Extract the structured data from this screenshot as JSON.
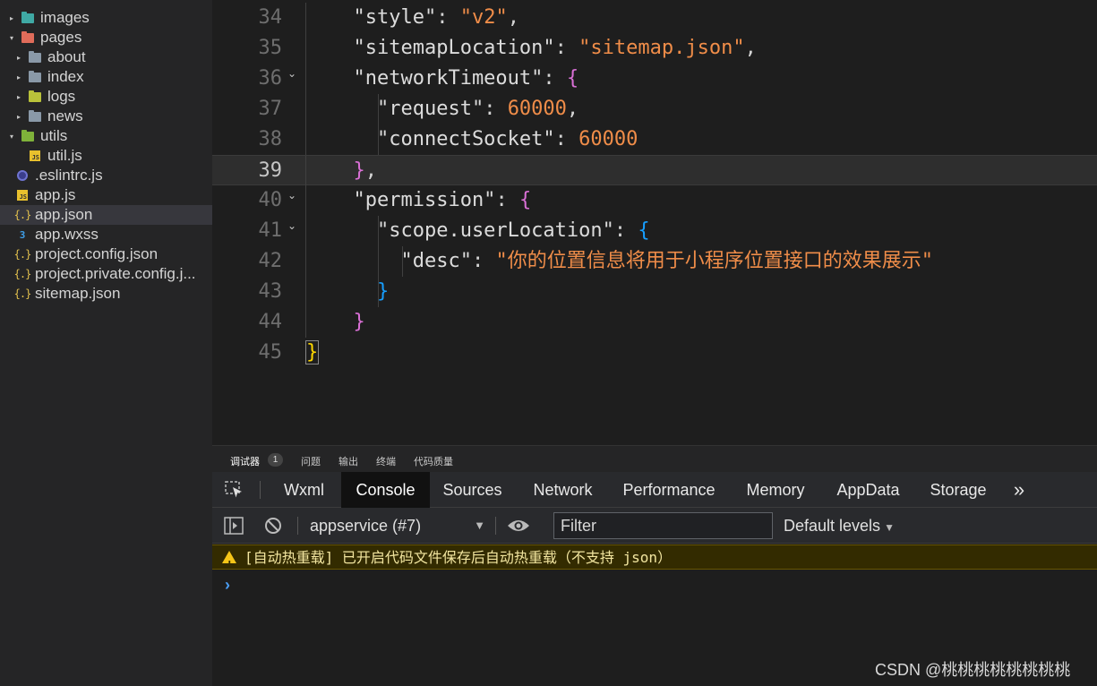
{
  "explorer": {
    "files": [
      {
        "label": "images",
        "icon": "folder-images-icon",
        "arrow": "▸",
        "selected": false
      },
      {
        "label": "pages",
        "icon": "folder-pages-icon",
        "arrow": "▾",
        "selected": false
      },
      {
        "label": "about",
        "icon": "folder-icon",
        "arrow": "▸",
        "selected": false
      },
      {
        "label": "index",
        "icon": "folder-icon",
        "arrow": "▸",
        "selected": false
      },
      {
        "label": "logs",
        "icon": "folder-logs-icon",
        "arrow": "▸",
        "selected": false
      },
      {
        "label": "news",
        "icon": "folder-icon",
        "arrow": "▸",
        "selected": false
      },
      {
        "label": "utils",
        "icon": "folder-utils-icon",
        "arrow": "▾",
        "selected": false
      },
      {
        "label": "util.js",
        "icon": "js-file-icon",
        "arrow": "",
        "selected": false
      },
      {
        "label": ".eslintrc.js",
        "icon": "eslint-file-icon",
        "arrow": "",
        "selected": false
      },
      {
        "label": "app.js",
        "icon": "js-file-icon",
        "arrow": "",
        "selected": false
      },
      {
        "label": "app.json",
        "icon": "json-file-icon",
        "arrow": "",
        "selected": true
      },
      {
        "label": "app.wxss",
        "icon": "css-file-icon",
        "arrow": "",
        "selected": false
      },
      {
        "label": "project.config.json",
        "icon": "json-file-icon",
        "arrow": "",
        "selected": false
      },
      {
        "label": "project.private.config.j...",
        "icon": "json-file-icon",
        "arrow": "",
        "selected": false
      },
      {
        "label": "sitemap.json",
        "icon": "json-file-icon",
        "arrow": "",
        "selected": false
      }
    ]
  },
  "editor": {
    "lines": [
      {
        "num": "34",
        "tokens": [
          [
            "k",
            "  \"style\""
          ],
          [
            "p",
            ": "
          ],
          [
            "s",
            "\"v2\""
          ],
          [
            "p",
            ","
          ]
        ]
      },
      {
        "num": "35",
        "tokens": [
          [
            "k",
            "  \"sitemapLocation\""
          ],
          [
            "p",
            ": "
          ],
          [
            "s",
            "\"sitemap.json\""
          ],
          [
            "p",
            ","
          ]
        ]
      },
      {
        "num": "36",
        "fold": "⌄",
        "tokens": [
          [
            "k",
            "  \"networkTimeout\""
          ],
          [
            "p",
            ": "
          ],
          [
            "b1",
            "{"
          ]
        ]
      },
      {
        "num": "37",
        "tokens": [
          [
            "k",
            "    \"request\""
          ],
          [
            "p",
            ": "
          ],
          [
            "n",
            "60000"
          ],
          [
            "p",
            ","
          ]
        ]
      },
      {
        "num": "38",
        "tokens": [
          [
            "k",
            "    \"connectSocket\""
          ],
          [
            "p",
            ": "
          ],
          [
            "n",
            "60000"
          ]
        ]
      },
      {
        "num": "39",
        "active": true,
        "tokens": [
          [
            "b1",
            "  }"
          ],
          [
            "p",
            ","
          ]
        ]
      },
      {
        "num": "40",
        "fold": "⌄",
        "tokens": [
          [
            "k",
            "  \"permission\""
          ],
          [
            "p",
            ": "
          ],
          [
            "b1",
            "{"
          ]
        ]
      },
      {
        "num": "41",
        "fold": "⌄",
        "tokens": [
          [
            "k",
            "    \"scope.userLocation\""
          ],
          [
            "p",
            ": "
          ],
          [
            "b2",
            "{"
          ]
        ]
      },
      {
        "num": "42",
        "tokens": [
          [
            "k",
            "      \"desc\""
          ],
          [
            "p",
            ": "
          ],
          [
            "s",
            "\"你的位置信息将用于小程序位置接口的效果展示\""
          ]
        ]
      },
      {
        "num": "43",
        "tokens": [
          [
            "b2",
            "    }"
          ]
        ]
      },
      {
        "num": "44",
        "tokens": [
          [
            "b1",
            "  }"
          ]
        ]
      },
      {
        "num": "45",
        "tokens": [
          [
            "b0",
            "}"
          ]
        ]
      }
    ]
  },
  "panel": {
    "tabs": [
      "调试器",
      "问题",
      "输出",
      "终端",
      "代码质量"
    ],
    "badge": "1",
    "devtools_tabs": [
      "Wxml",
      "Console",
      "Sources",
      "Network",
      "Performance",
      "Memory",
      "AppData",
      "Storage"
    ],
    "more_tabs": "»",
    "context": "appservice (#7)",
    "context_arrow": "▼",
    "filter_placeholder": "Filter",
    "levels": "Default levels",
    "levels_arrow": "▼",
    "warning": "[自动热重载] 已开启代码文件保存后自动热重载（不支持 json）",
    "prompt": "›"
  },
  "watermark": "CSDN @桃桃桃桃桃桃桃桃"
}
